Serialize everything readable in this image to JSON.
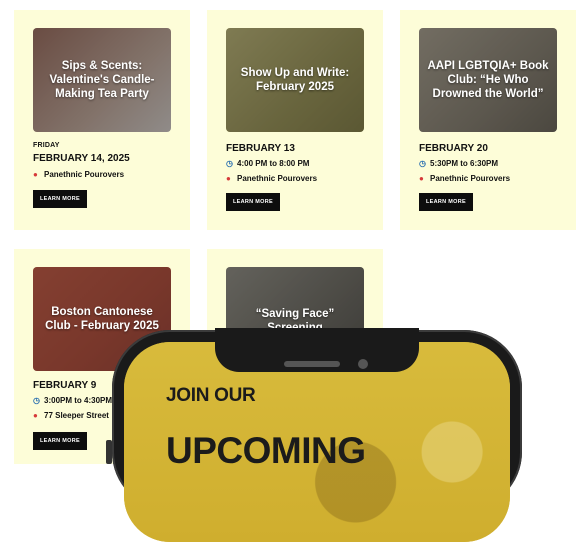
{
  "events": [
    {
      "thumb_title": "Sips & Scents: Valentine's Candle-Making Tea Party",
      "thumb_colors": [
        "#8a5a4a",
        "#c9a08a"
      ],
      "day": "FRIDAY",
      "date": "FEBRUARY 14, 2025",
      "time": "",
      "location": "Panethnic Pourovers",
      "button": "LEARN MORE"
    },
    {
      "thumb_title": "Show Up and Write: February 2025",
      "thumb_colors": [
        "#8f8a3c",
        "#b9b26a"
      ],
      "day": "",
      "date": "FEBRUARY 13",
      "time": "4:00 PM to 8:00 PM",
      "location": "Panethnic Pourovers",
      "button": "LEARN MORE"
    },
    {
      "thumb_title": "AAPI LGBTQIA+ Book Club: “He Who Drowned the World”",
      "thumb_colors": [
        "#7a7164",
        "#a59a86"
      ],
      "day": "",
      "date": "FEBRUARY 20",
      "time": "5:30PM to 6:30PM",
      "location": "Panethnic Pourovers",
      "button": "LEARN MORE"
    },
    {
      "thumb_title": "Boston Cantonese Club - February 2025",
      "thumb_colors": [
        "#b8432c",
        "#d8784a"
      ],
      "day": "",
      "date": "FEBRUARY 9",
      "time": "3:00PM to 4:30PM",
      "location": "77 Sleeper Street",
      "button": "LEARN MORE"
    },
    {
      "thumb_title": "“Saving Face” Screening",
      "thumb_colors": [
        "#5f5d53",
        "#8a877c"
      ],
      "day": "",
      "date": "",
      "time": "",
      "location": "",
      "button": ""
    }
  ],
  "promo": {
    "line1": "JOIN OUR",
    "line2": "UPCOMING"
  },
  "icons": {
    "time": "clock-icon",
    "location": "map-pin-icon"
  }
}
